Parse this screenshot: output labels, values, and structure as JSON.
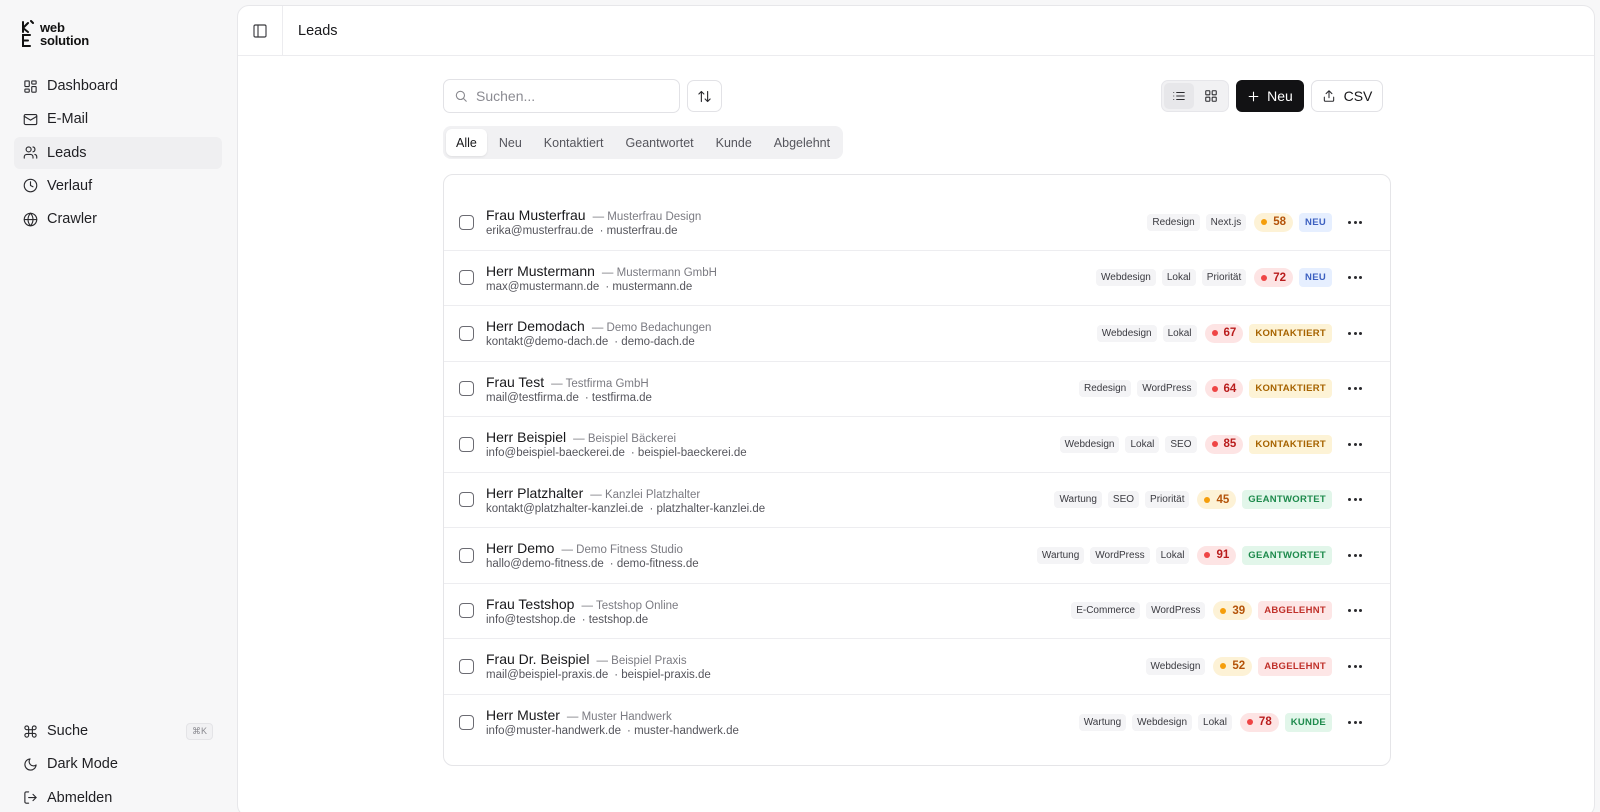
{
  "app": {
    "logo_line1": "web",
    "logo_line2": "solution"
  },
  "sidebar": {
    "items": [
      {
        "label": "Dashboard",
        "icon": "dashboard-icon"
      },
      {
        "label": "E-Mail",
        "icon": "mail-icon"
      },
      {
        "label": "Leads",
        "icon": "users-icon",
        "active": true
      },
      {
        "label": "Verlauf",
        "icon": "clock-icon"
      },
      {
        "label": "Crawler",
        "icon": "globe-icon"
      }
    ],
    "bottom": [
      {
        "label": "Suche",
        "icon": "command-icon",
        "shortcut": "⌘K"
      },
      {
        "label": "Dark Mode",
        "icon": "moon-icon"
      },
      {
        "label": "Abmelden",
        "icon": "logout-icon"
      }
    ]
  },
  "header": {
    "title": "Leads"
  },
  "toolbar": {
    "search_placeholder": "Suchen...",
    "new_label": "Neu",
    "csv_label": "CSV"
  },
  "tabs": [
    {
      "label": "Alle",
      "active": true
    },
    {
      "label": "Neu"
    },
    {
      "label": "Kontaktiert"
    },
    {
      "label": "Geantwortet"
    },
    {
      "label": "Kunde"
    },
    {
      "label": "Abgelehnt"
    }
  ],
  "colors": {
    "score_orange_bg": "#fdf2d6",
    "score_orange_text": "#b45309",
    "score_orange_dot": "#f59e0b",
    "score_red_bg": "#fde4e4",
    "score_red_text": "#b91c1c",
    "score_red_dot": "#ef4444"
  },
  "statuses": {
    "NEU": {
      "bg": "#e6efff",
      "fg": "#3b5fc0"
    },
    "KONTAKTIERT": {
      "bg": "#fdf3d6",
      "fg": "#a66300"
    },
    "GEANTWORTET": {
      "bg": "#e2f6ea",
      "fg": "#1d8a4c"
    },
    "ABGELEHNT": {
      "bg": "#fde6e6",
      "fg": "#c0312b"
    },
    "KUNDE": {
      "bg": "#e2f6ea",
      "fg": "#1d8a4c"
    }
  },
  "leads": [
    {
      "name": "Frau Musterfrau",
      "company": "— Musterfrau Design",
      "email": "erika@musterfrau.de",
      "domain": "· musterfrau.de",
      "tags": [
        "Redesign",
        "Next.js"
      ],
      "score": "58",
      "score_color": "orange",
      "status": "NEU"
    },
    {
      "name": "Herr Mustermann",
      "company": "— Mustermann GmbH",
      "email": "max@mustermann.de",
      "domain": "· mustermann.de",
      "tags": [
        "Webdesign",
        "Lokal",
        "Priorität"
      ],
      "score": "72",
      "score_color": "red",
      "status": "NEU"
    },
    {
      "name": "Herr Demodach",
      "company": "— Demo Bedachungen",
      "email": "kontakt@demo-dach.de",
      "domain": "· demo-dach.de",
      "tags": [
        "Webdesign",
        "Lokal"
      ],
      "score": "67",
      "score_color": "red",
      "status": "KONTAKTIERT"
    },
    {
      "name": "Frau Test",
      "company": "— Testfirma GmbH",
      "email": "mail@testfirma.de",
      "domain": "· testfirma.de",
      "tags": [
        "Redesign",
        "WordPress"
      ],
      "score": "64",
      "score_color": "red",
      "status": "KONTAKTIERT"
    },
    {
      "name": "Herr Beispiel",
      "company": "— Beispiel Bäckerei",
      "email": "info@beispiel-baeckerei.de",
      "domain": "· beispiel-baeckerei.de",
      "tags": [
        "Webdesign",
        "Lokal",
        "SEO"
      ],
      "score": "85",
      "score_color": "red",
      "status": "KONTAKTIERT"
    },
    {
      "name": "Herr Platzhalter",
      "company": "— Kanzlei Platzhalter",
      "email": "kontakt@platzhalter-kanzlei.de",
      "domain": "· platzhalter-kanzlei.de",
      "tags": [
        "Wartung",
        "SEO",
        "Priorität"
      ],
      "score": "45",
      "score_color": "orange",
      "status": "GEANTWORTET"
    },
    {
      "name": "Herr Demo",
      "company": "— Demo Fitness Studio",
      "email": "hallo@demo-fitness.de",
      "domain": "· demo-fitness.de",
      "tags": [
        "Wartung",
        "WordPress",
        "Lokal"
      ],
      "score": "91",
      "score_color": "red",
      "status": "GEANTWORTET"
    },
    {
      "name": "Frau Testshop",
      "company": "— Testshop Online",
      "email": "info@testshop.de",
      "domain": "· testshop.de",
      "tags": [
        "E-Commerce",
        "WordPress"
      ],
      "score": "39",
      "score_color": "orange",
      "status": "ABGELEHNT"
    },
    {
      "name": "Frau Dr. Beispiel",
      "company": "— Beispiel Praxis",
      "email": "mail@beispiel-praxis.de",
      "domain": "· beispiel-praxis.de",
      "tags": [
        "Webdesign"
      ],
      "score": "52",
      "score_color": "orange",
      "status": "ABGELEHNT"
    },
    {
      "name": "Herr Muster",
      "company": "— Muster Handwerk",
      "email": "info@muster-handwerk.de",
      "domain": "· muster-handwerk.de",
      "tags": [
        "Wartung",
        "Webdesign",
        "Lokal"
      ],
      "score": "78",
      "score_color": "red",
      "status": "KUNDE"
    }
  ]
}
